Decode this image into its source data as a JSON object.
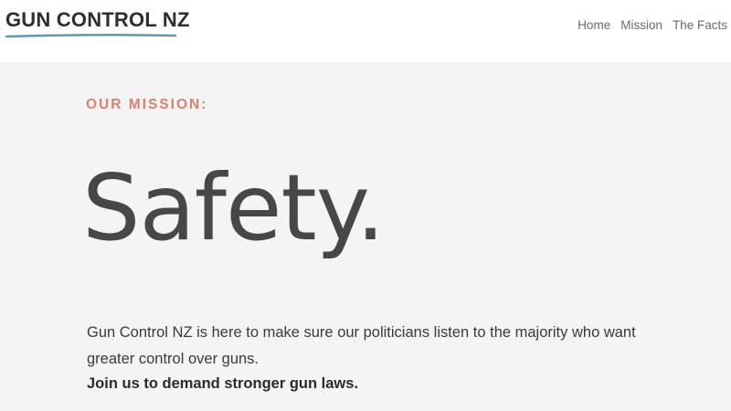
{
  "header": {
    "logo_text": "GUN CONTROL NZ",
    "nav": [
      {
        "label": "Home"
      },
      {
        "label": "Mission"
      },
      {
        "label": "The Facts"
      }
    ]
  },
  "main": {
    "eyebrow": "OUR MISSION:",
    "headline": "Safety.",
    "body": "Gun Control NZ is here to make sure our politicians listen to the majority who want greater control over guns.",
    "cta": "Join us to demand stronger gun laws."
  },
  "colors": {
    "accent": "#d7826f",
    "underline": "#5b9bb0",
    "background": "#f4f4f4",
    "header_bg": "#ffffff"
  }
}
